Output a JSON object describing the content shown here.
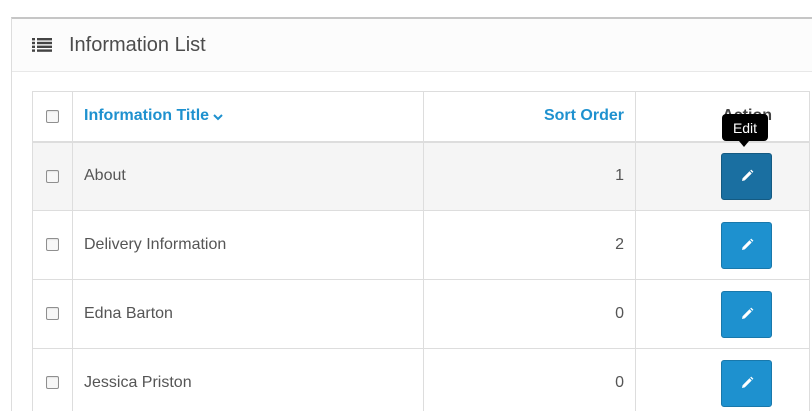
{
  "panel": {
    "title": "Information List",
    "icon": "list-icon"
  },
  "table": {
    "headers": {
      "title": "Information Title",
      "sort_order": "Sort Order",
      "action": "Action"
    },
    "sort_indicator_icon": "chevron-down-icon",
    "rows": [
      {
        "title": "About",
        "sort_order": "1"
      },
      {
        "title": "Delivery Information",
        "sort_order": "2"
      },
      {
        "title": "Edna Barton",
        "sort_order": "0"
      },
      {
        "title": "Jessica Priston",
        "sort_order": "0"
      }
    ],
    "edit_icon": "pencil-icon"
  },
  "tooltip": {
    "text": "Edit"
  },
  "colors": {
    "accent": "#1e91cf",
    "button_active": "#1a6fa1",
    "tooltip_bg": "#000000"
  }
}
